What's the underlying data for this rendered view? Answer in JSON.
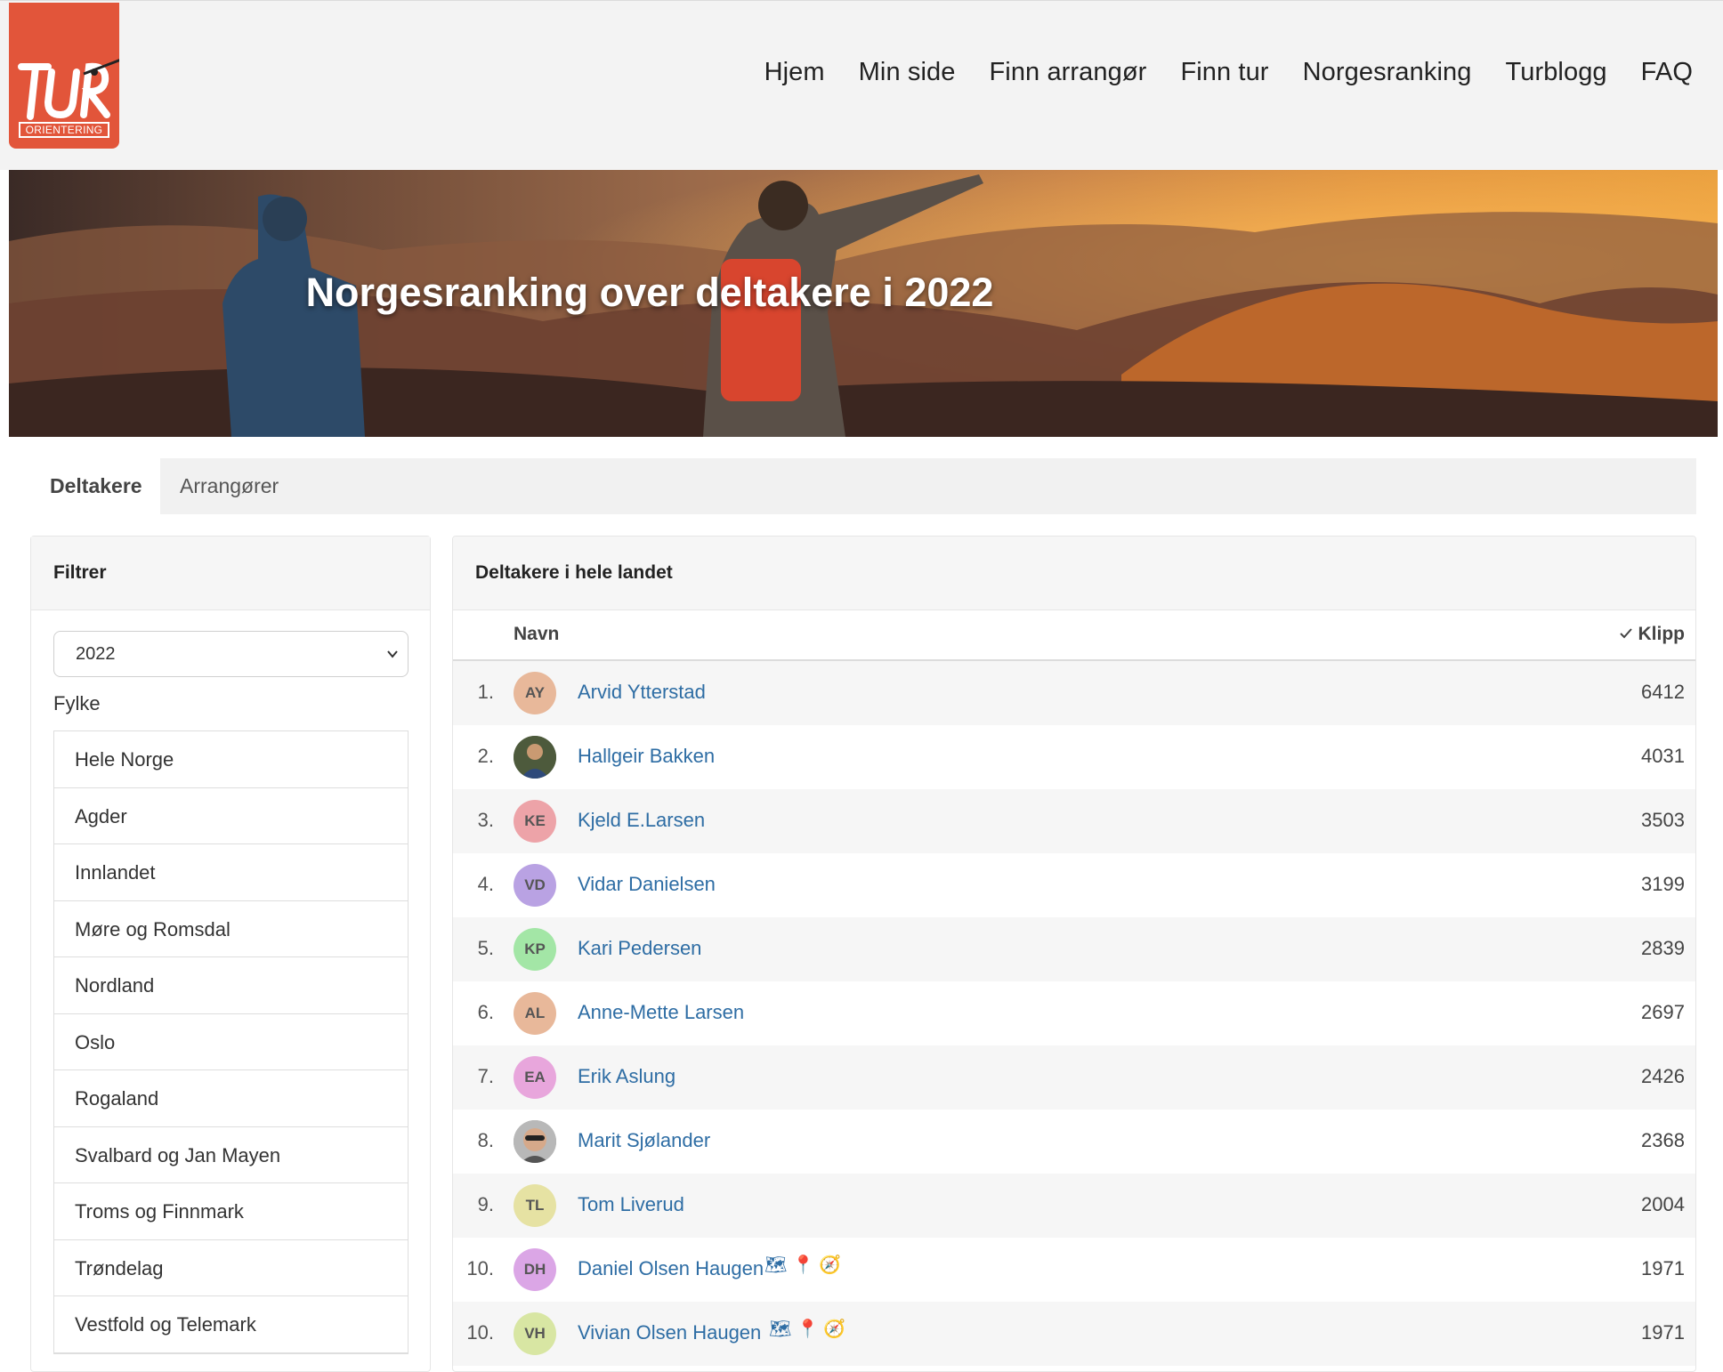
{
  "logo": {
    "text": "TUR",
    "subtext": "ORIENTERING"
  },
  "nav": [
    "Hjem",
    "Min side",
    "Finn arrangør",
    "Finn tur",
    "Norgesranking",
    "Turblogg",
    "FAQ"
  ],
  "hero": {
    "title": "Norgesranking over deltakere i 2022"
  },
  "tabs": {
    "active": "Deltakere",
    "inactive": "Arrangører"
  },
  "filter": {
    "title": "Filtrer",
    "year": "2022",
    "fylke_label": "Fylke",
    "regions": [
      "Hele Norge",
      "Agder",
      "Innlandet",
      "Møre og Romsdal",
      "Nordland",
      "Oslo",
      "Rogaland",
      "Svalbard og Jan Mayen",
      "Troms og Finnmark",
      "Trøndelag",
      "Vestfold og Telemark"
    ]
  },
  "ranking": {
    "title": "Deltakere i hele landet",
    "col_name": "Navn",
    "col_points": "Klipp",
    "rows": [
      {
        "rank": "1.",
        "initials": "AY",
        "name": "Arvid Ytterstad",
        "points": "6412",
        "avatar_color": "#e8b89a"
      },
      {
        "rank": "2.",
        "initials": "",
        "name": "Hallgeir Bakken",
        "points": "4031",
        "avatar_color": "#5b6b4a"
      },
      {
        "rank": "3.",
        "initials": "KE",
        "name": "Kjeld E.Larsen",
        "points": "3503",
        "avatar_color": "#eda3a8"
      },
      {
        "rank": "4.",
        "initials": "VD",
        "name": "Vidar Danielsen",
        "points": "3199",
        "avatar_color": "#b9a2e3"
      },
      {
        "rank": "5.",
        "initials": "KP",
        "name": "Kari Pedersen",
        "points": "2839",
        "avatar_color": "#a3e6a6"
      },
      {
        "rank": "6.",
        "initials": "AL",
        "name": "Anne-Mette Larsen",
        "points": "2697",
        "avatar_color": "#e8b89a"
      },
      {
        "rank": "7.",
        "initials": "EA",
        "name": "Erik Aslung",
        "points": "2426",
        "avatar_color": "#e8a6dc"
      },
      {
        "rank": "8.",
        "initials": "",
        "name": "Marit Sjølander",
        "points": "2368",
        "avatar_color": "#9a9a9a"
      },
      {
        "rank": "9.",
        "initials": "TL",
        "name": "Tom Liverud",
        "points": "2004",
        "avatar_color": "#e6e2a3"
      },
      {
        "rank": "10.",
        "initials": "DH",
        "name": "Daniel Olsen Haugen",
        "points": "1971",
        "avatar_color": "#dba6e6"
      },
      {
        "rank": "10.",
        "initials": "VH",
        "name": "Vivian Olsen Haugen",
        "points": "1971",
        "avatar_color": "#d8e6a3"
      }
    ]
  }
}
